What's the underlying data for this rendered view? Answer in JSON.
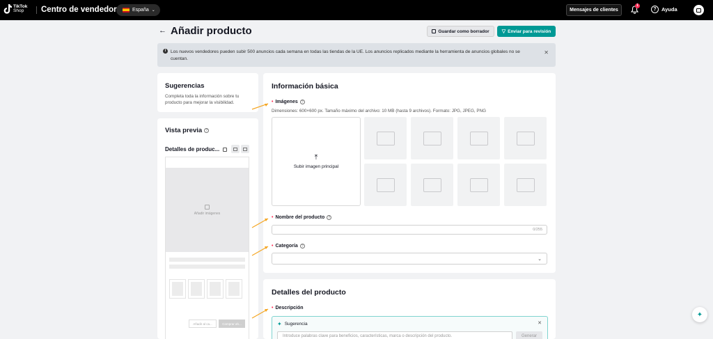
{
  "topbar": {
    "logo_line1": "TikTok",
    "logo_line2": "Shop",
    "app_title": "Centro de vendedores",
    "region": "España",
    "messages_button": "Mensajes de clientes",
    "notification_count": "1",
    "help_label": "Ayuda"
  },
  "header": {
    "title": "Añadir producto",
    "save_draft": "Guardar como borrador",
    "submit": "Enviar para revisión"
  },
  "notice": {
    "text": "Los nuevos vendedores pueden subir 500 anuncios cada semana en todas las tiendas de la UE. Los anuncios replicados mediante la herramienta de anuncios globales no se cuentan."
  },
  "suggestions": {
    "title": "Sugerencias",
    "text": "Completa toda la información sobre tu producto para mejorar la visibilidad."
  },
  "preview": {
    "title": "Vista previa",
    "subtitle": "Detalles de produc...",
    "add_images": "Añadir imágenes",
    "btn_a": "Añadir al ca...",
    "btn_b": "Comprar ah..."
  },
  "basic_info": {
    "title": "Información básica",
    "images_label": "Imágenes",
    "images_hint": "Dimensiones: 600×600 px. Tamaño máximo del archivo: 10 MB (hasta 9 archivos). Formato: JPG, JPEG, PNG",
    "upload_main": "Subir imagen principal",
    "name_label": "Nombre del producto",
    "name_counter": "0/255",
    "category_label": "Categoría"
  },
  "product_details": {
    "title": "Detalles del producto",
    "description_label": "Descripción",
    "suggestion_title": "Sugerencia",
    "suggestion_placeholder": "Introduce palabras clave para beneficios, características, marca o descripción del producto.",
    "generate": "Generar"
  },
  "colors": {
    "accent": "#009995",
    "required": "#fe2c55",
    "arrow": "#f5a623"
  }
}
